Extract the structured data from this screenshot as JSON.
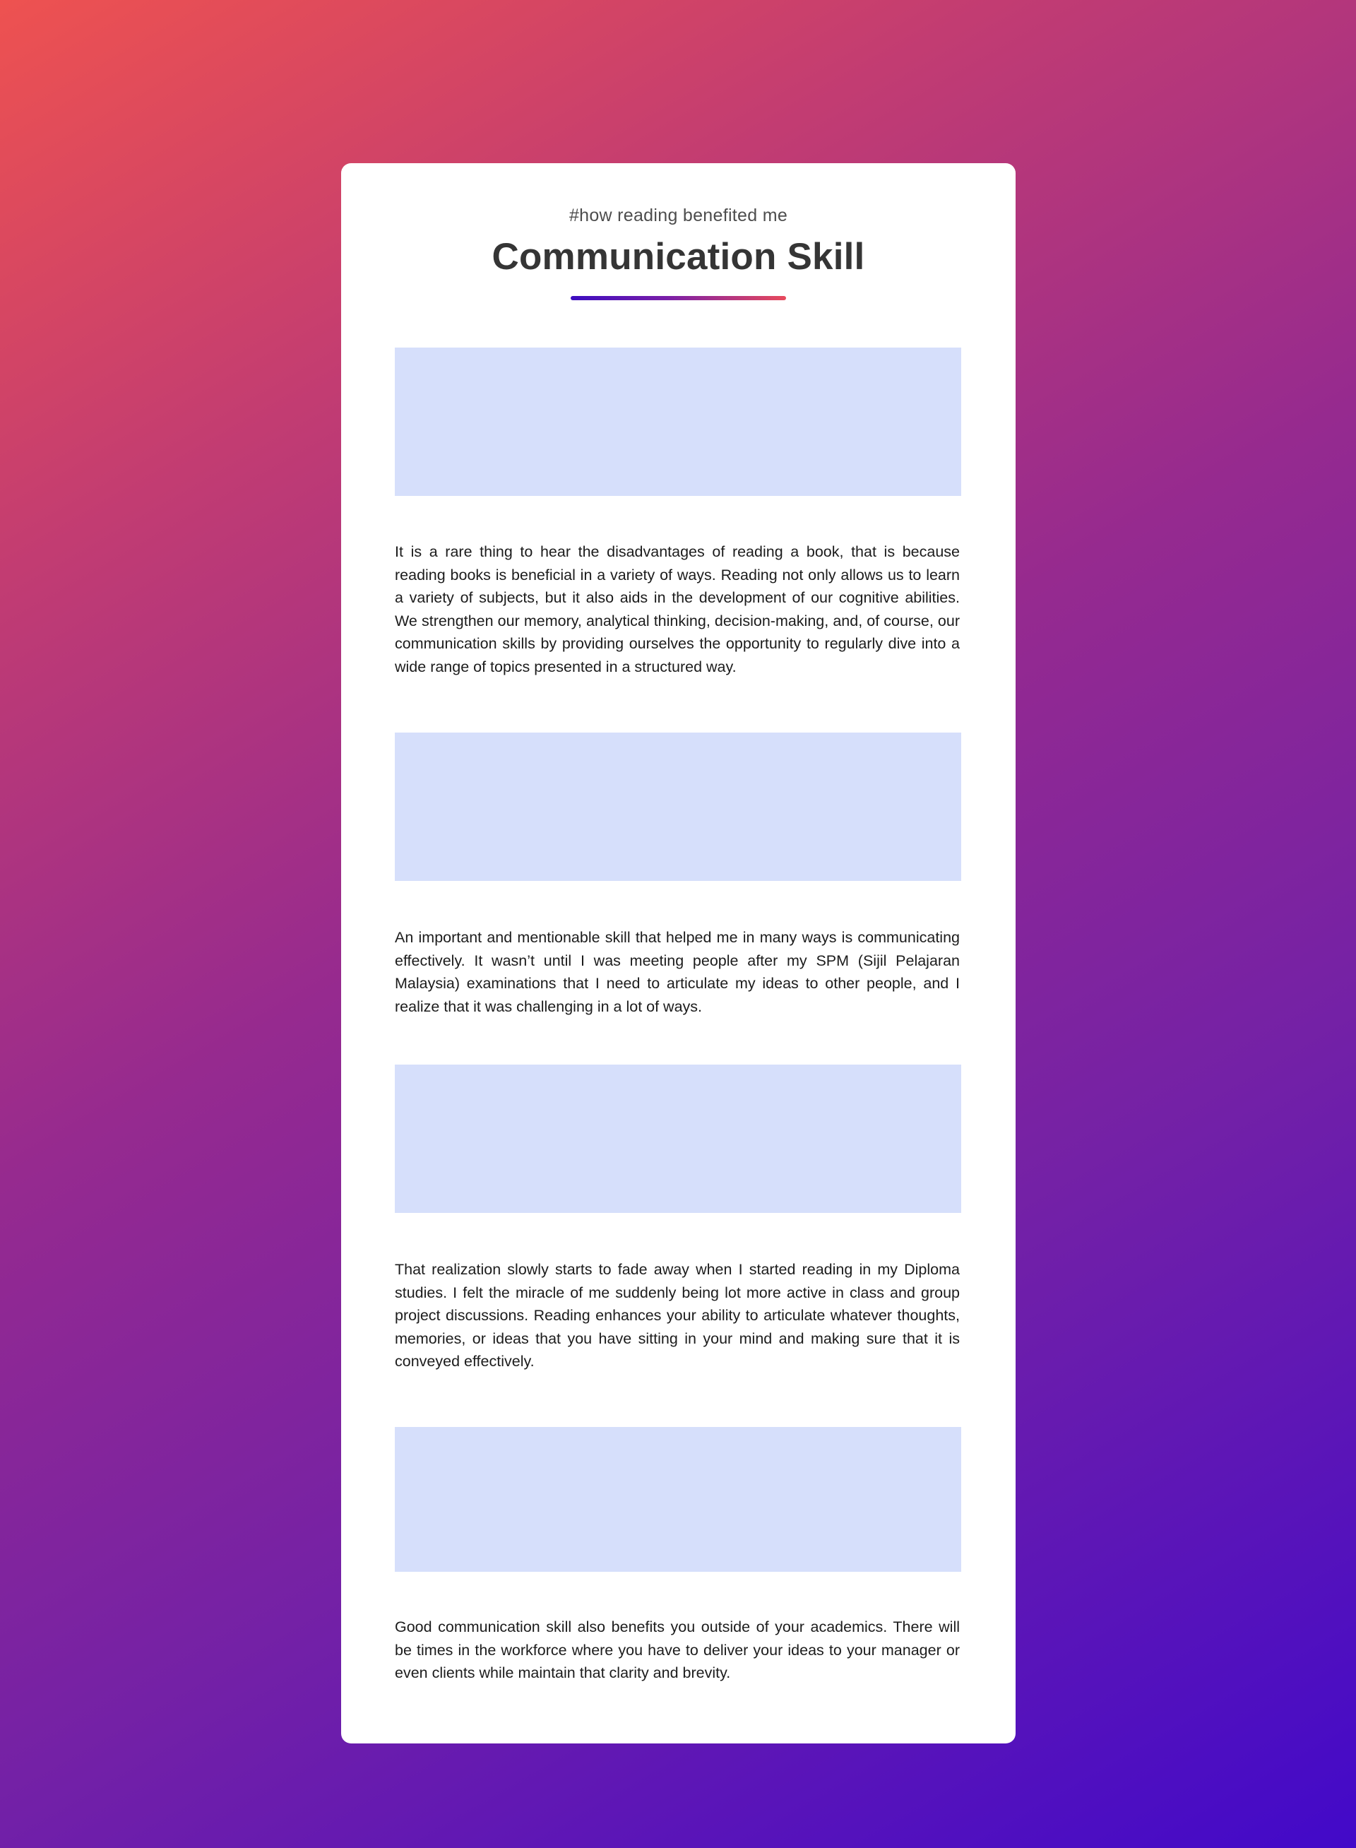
{
  "article": {
    "kicker": "#how reading benefited me",
    "title": "Communication Skill",
    "paragraphs": [
      "It is a rare thing to hear the disadvantages of reading a book, that is because reading books is beneficial in a variety of ways. Reading not only allows us to learn a variety of subjects, but it also aids in the development of our cognitive abilities. We strengthen our memory, analytical thinking, decision-making, and, of course, our communication skills by providing ourselves the opportunity to regularly dive into a wide range of topics presented in a structured way.",
      "An important and mentionable skill that helped me in many ways is communicating effectively. It wasn’t until I was meeting people after my SPM (Sijil Pelajaran Malaysia) examinations that I need to articulate my ideas to other people, and I realize that it was challenging in a lot of ways.",
      "That realization slowly starts to fade away when I started reading in my Diploma studies. I felt the miracle of me suddenly being lot more active in class and group project discussions. Reading enhances your ability to articulate whatever thoughts, memories, or ideas that you have sitting in your mind and making sure that it is conveyed effectively.",
      "Good communication skill also benefits you outside of your academics. There will be times in the workforce where you have to deliver your ideas to your manager or even clients while maintain that clarity and brevity."
    ]
  },
  "colors": {
    "background_gradient": [
      "#ee5250",
      "#962a8f",
      "#4209c9"
    ],
    "card": "#ffffff",
    "placeholder": "#d6dffb",
    "underline_gradient": [
      "#3c0dc0",
      "#e84a5c"
    ],
    "heading_text": "#353535",
    "body_text": "#1c1c1c"
  }
}
